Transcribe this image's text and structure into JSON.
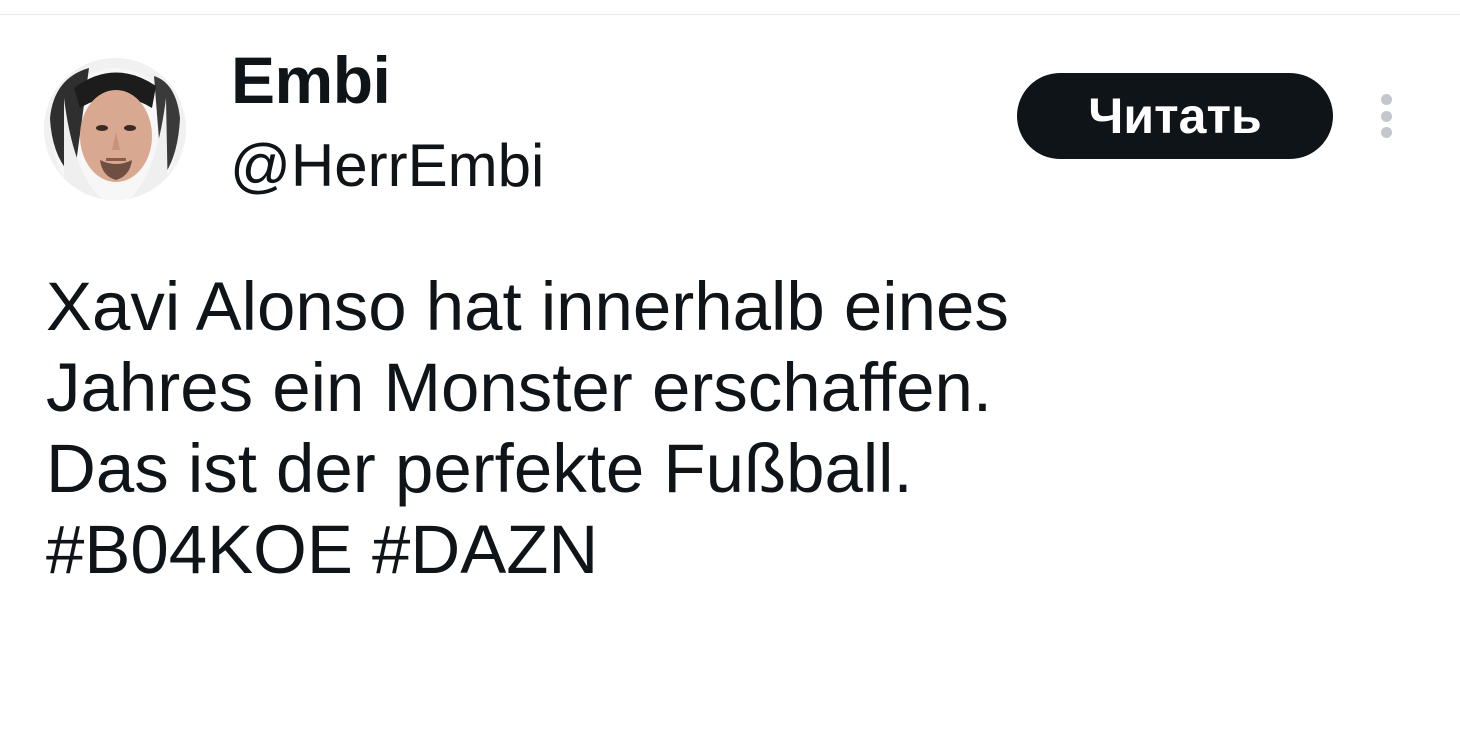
{
  "author": {
    "display_name": "Embi",
    "handle": "@HerrEmbi"
  },
  "follow_button": {
    "label": "Читать"
  },
  "more_menu": {
    "icon": "more-vertical-icon"
  },
  "tweet": {
    "lines": [
      "Xavi Alonso hat innerhalb eines",
      "Jahres ein Monster erschaffen.",
      "Das ist der perfekte Fußball."
    ],
    "hashtags": [
      "#B04KOE",
      "#DAZN"
    ]
  },
  "colors": {
    "text": "#0f1419",
    "button_bg": "#0f1419",
    "button_text": "#ffffff",
    "divider": "#e7e9ea",
    "menu_dots": "#c4c8cc"
  }
}
